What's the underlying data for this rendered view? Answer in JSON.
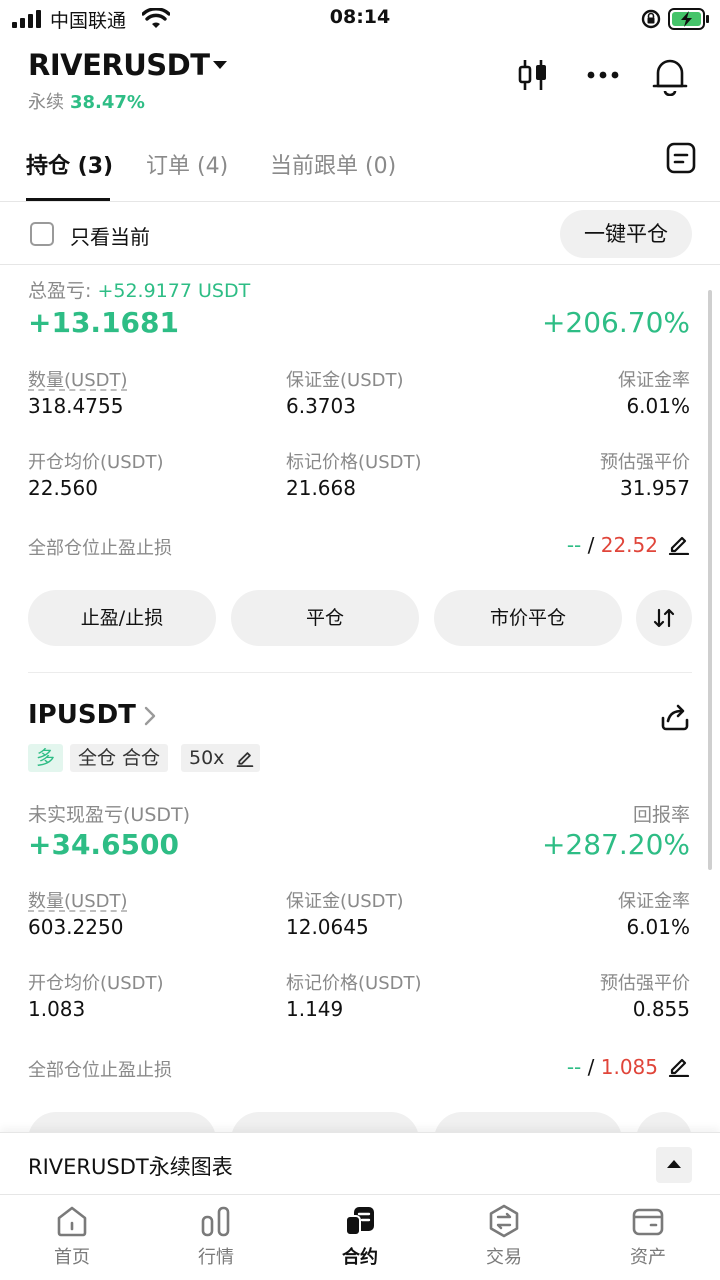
{
  "status_bar": {
    "carrier": "中国联通",
    "time": "08:14"
  },
  "header": {
    "symbol": "RIVERUSDT",
    "subtitle_label": "永续",
    "subtitle_change": "38.47%"
  },
  "tabs": [
    {
      "label": "持仓 (3)",
      "active": true
    },
    {
      "label": "订单 (4)",
      "active": false
    },
    {
      "label": "当前跟单 (0)",
      "active": false
    }
  ],
  "filter": {
    "only_current_label": "只看当前",
    "close_all_label": "一键平仓"
  },
  "position1": {
    "total_pnl_label": "总盈亏:",
    "total_pnl_value": "+52.9177 USDT",
    "pnl": "+13.1681",
    "roi": "+206.70%",
    "qty_label": "数量(USDT)",
    "qty": "318.4755",
    "margin_label": "保证金(USDT)",
    "margin": "6.3703",
    "margin_ratio_label": "保证金率",
    "margin_ratio": "6.01%",
    "entry_label": "开仓均价(USDT)",
    "entry": "22.560",
    "mark_label": "标记价格(USDT)",
    "mark": "21.668",
    "liq_label": "预估强平价",
    "liq": "31.957",
    "tpsl_label": "全部仓位止盈止损",
    "tp": "--",
    "sep": "/",
    "sl": "22.52",
    "btn_tpsl": "止盈/止损",
    "btn_close": "平仓",
    "btn_market_close": "市价平仓"
  },
  "position2": {
    "symbol": "IPUSDT",
    "tag_side": "多",
    "tag_mode": "全仓 合仓",
    "tag_leverage": "50x",
    "pnl_label": "未实现盈亏(USDT)",
    "roi_label": "回报率",
    "pnl": "+34.6500",
    "roi": "+287.20%",
    "qty_label": "数量(USDT)",
    "qty": "603.2250",
    "margin_label": "保证金(USDT)",
    "margin": "12.0645",
    "margin_ratio_label": "保证金率",
    "margin_ratio": "6.01%",
    "entry_label": "开仓均价(USDT)",
    "entry": "1.083",
    "mark_label": "标记价格(USDT)",
    "mark": "1.149",
    "liq_label": "预估强平价",
    "liq": "0.855",
    "tpsl_label": "全部仓位止盈止损",
    "tp": "--",
    "sep": "/",
    "sl": "1.085"
  },
  "chart_bar": {
    "label": "RIVERUSDT永续图表"
  },
  "bottom_nav": [
    {
      "label": "首页",
      "icon": "home-icon"
    },
    {
      "label": "行情",
      "icon": "market-icon"
    },
    {
      "label": "合约",
      "icon": "futures-icon"
    },
    {
      "label": "交易",
      "icon": "trade-icon"
    },
    {
      "label": "资产",
      "icon": "wallet-icon"
    }
  ],
  "colors": {
    "up": "#2ebd85",
    "down": "#e0453a",
    "muted": "#8a8a8a"
  }
}
